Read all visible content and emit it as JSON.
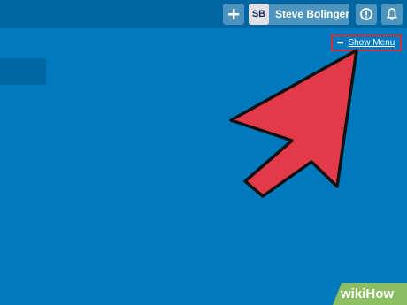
{
  "header": {
    "add_icon": "plus-icon",
    "avatar_initials": "SB",
    "username": "Steve Bolinger",
    "info_icon": "info-icon",
    "bell_icon": "bell-icon"
  },
  "board": {
    "show_menu_icon": "ellipsis-icon",
    "show_menu_label": "Show Menu",
    "background_color": "#0079bf",
    "header_color": "#0067a3"
  },
  "annotation": {
    "arrow_color": "#e23a48",
    "highlight_color": "#d92c3a"
  },
  "watermark": {
    "wiki": "wiki",
    "how": "How",
    "badge_color": "#8cbf63"
  }
}
